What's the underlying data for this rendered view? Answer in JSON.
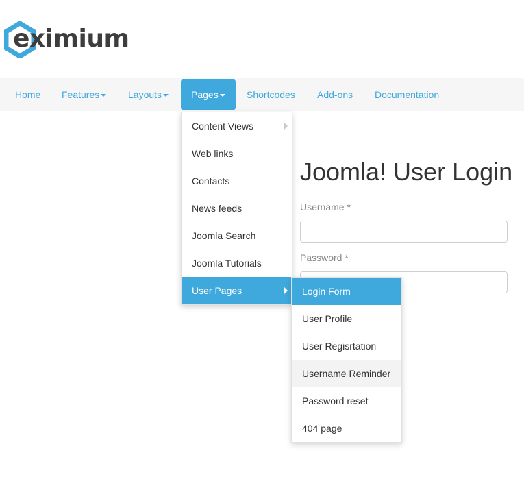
{
  "brand": {
    "logo_text": "eximium",
    "accent_color": "#3fa9de"
  },
  "nav": {
    "items": [
      {
        "label": "Home"
      },
      {
        "label": "Features"
      },
      {
        "label": "Layouts"
      },
      {
        "label": "Pages"
      },
      {
        "label": "Shortcodes"
      },
      {
        "label": "Add-ons"
      },
      {
        "label": "Documentation"
      }
    ],
    "active": "Pages"
  },
  "pages_menu": {
    "items": [
      {
        "label": "Content Views"
      },
      {
        "label": "Web links"
      },
      {
        "label": "Contacts"
      },
      {
        "label": "News feeds"
      },
      {
        "label": "Joomla Search"
      },
      {
        "label": "Joomla Tutorials"
      },
      {
        "label": "User Pages"
      }
    ],
    "active": "User Pages"
  },
  "user_pages_menu": {
    "items": [
      {
        "label": "Login Form"
      },
      {
        "label": "User Profile"
      },
      {
        "label": "User Regisrtation"
      },
      {
        "label": "Username Reminder"
      },
      {
        "label": "Password reset"
      },
      {
        "label": "404 page"
      }
    ],
    "active": "Login Form",
    "hovered": "Username Reminder"
  },
  "login": {
    "title": "Joomla! User Login",
    "username_label": "Username *",
    "username_value": "",
    "password_label": "Password *",
    "password_value": ""
  }
}
